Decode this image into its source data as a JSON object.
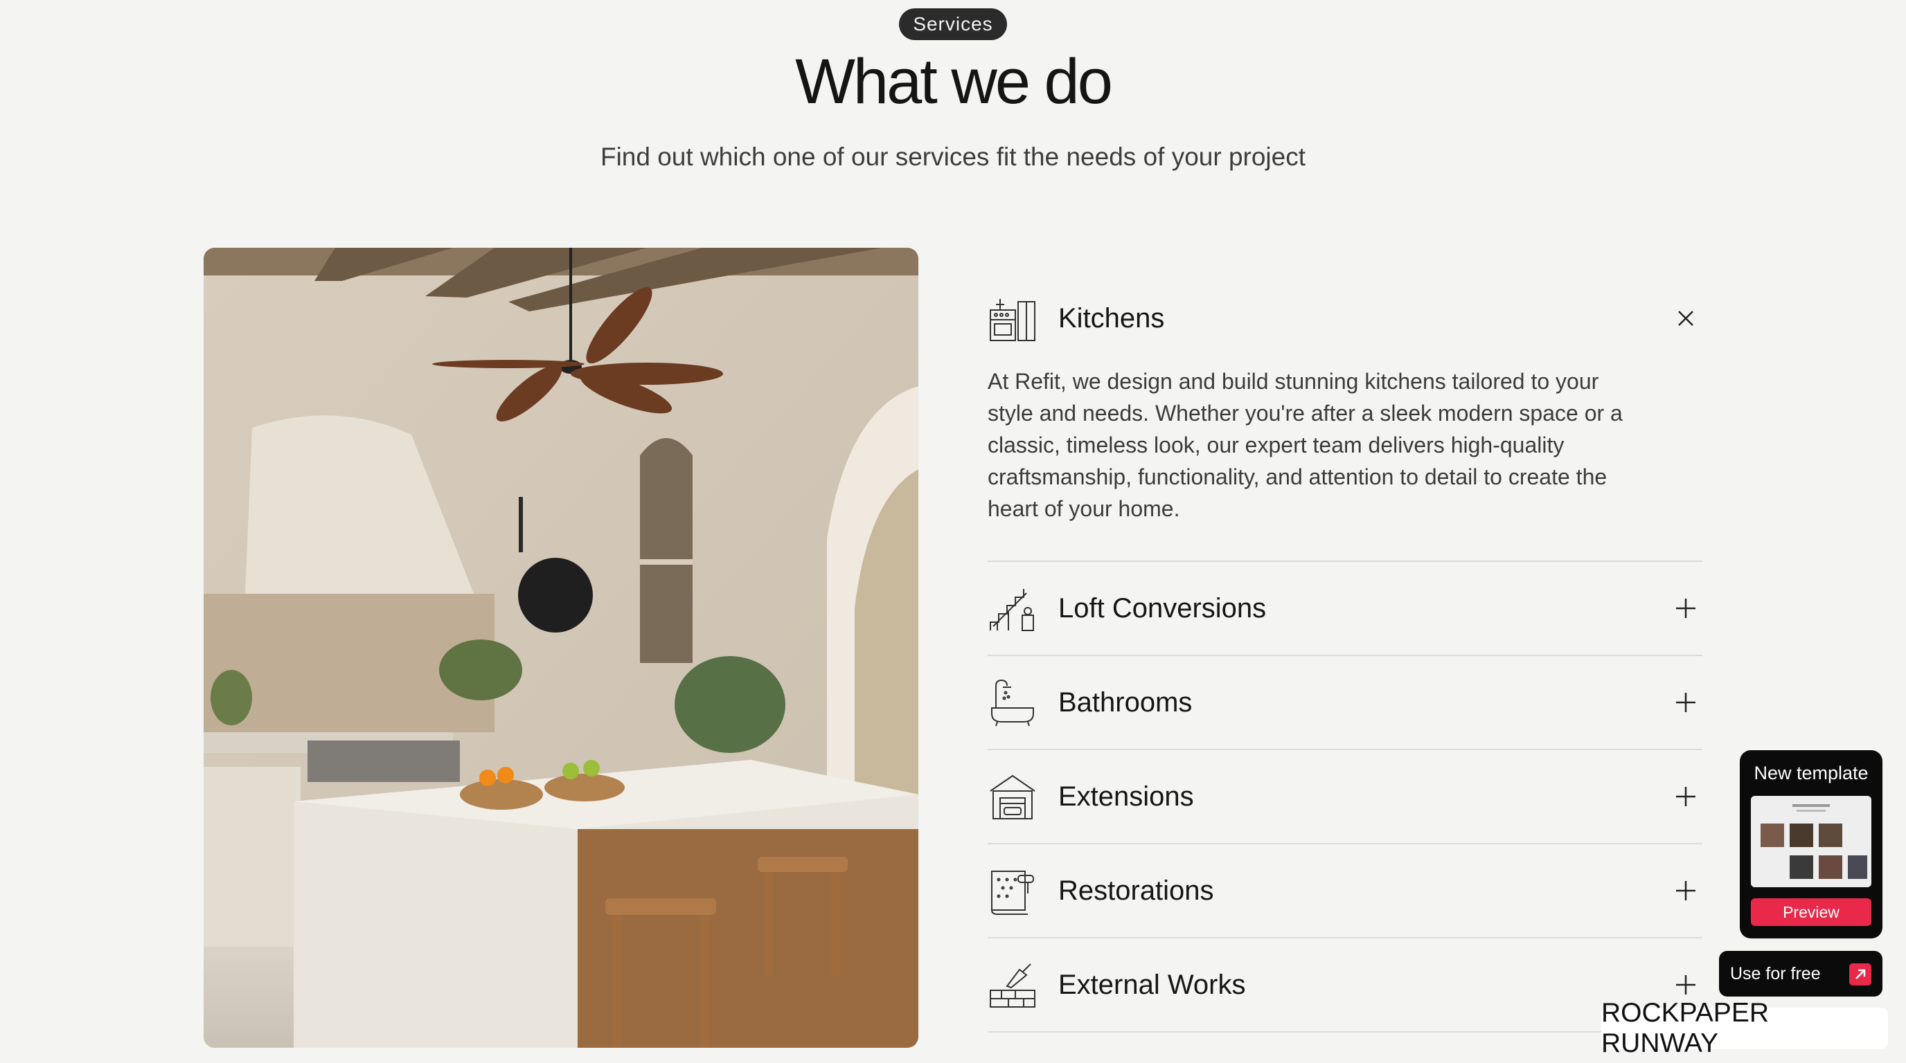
{
  "header": {
    "badge": "Services",
    "title": "What we do",
    "subtitle": "Find out which one of our services fit the needs of your project"
  },
  "services": [
    {
      "label": "Kitchens",
      "icon": "kitchen-icon",
      "expanded": true,
      "description": "At Refit, we design and build stunning kitchens tailored to your style and needs. Whether you're after a sleek modern space or a classic, timeless look, our expert team delivers high-quality craftsmanship, functionality, and attention to detail to create the heart of your home."
    },
    {
      "label": "Loft Conversions",
      "icon": "staircase-icon",
      "expanded": false
    },
    {
      "label": "Bathrooms",
      "icon": "bathtub-icon",
      "expanded": false
    },
    {
      "label": "Extensions",
      "icon": "house-garage-icon",
      "expanded": false
    },
    {
      "label": "Restorations",
      "icon": "wallpaper-roller-icon",
      "expanded": false
    },
    {
      "label": "External Works",
      "icon": "brick-trowel-icon",
      "expanded": false
    }
  ],
  "promo": {
    "title": "New template",
    "preview_label": "Preview",
    "use_label": "Use for free",
    "brand": "ROCKPAPER RUNWAY"
  },
  "colors": {
    "background": "#f4f4f2",
    "accent": "#e8294a",
    "badge": "#2b2b2b"
  }
}
